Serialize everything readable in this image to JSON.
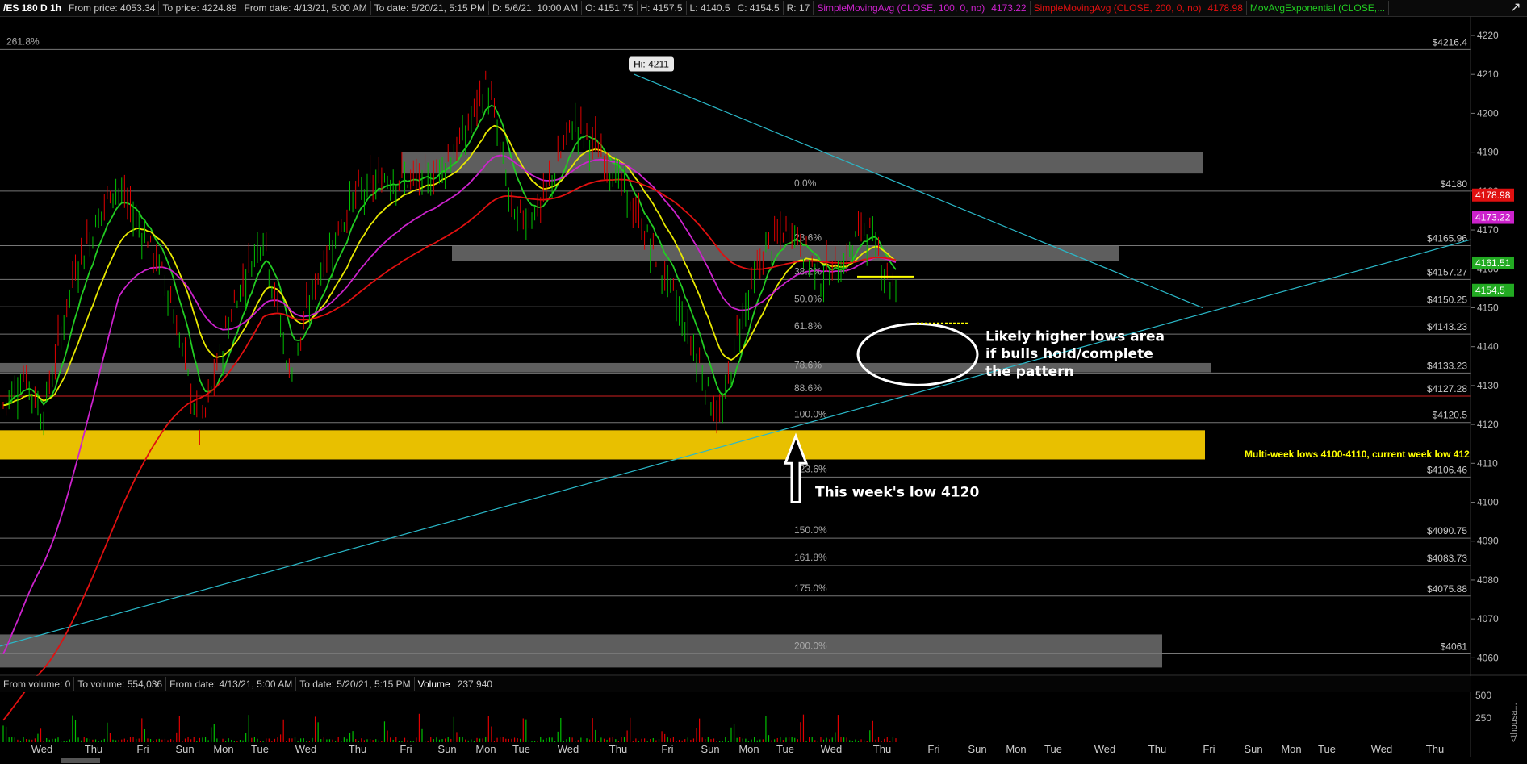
{
  "header": {
    "symbol": "/ES 180 D 1h",
    "from_price": "From price: 4053.34",
    "to_price": "To price: 4224.89",
    "from_date": "From date: 4/13/21, 5:00 AM",
    "to_date": "To date: 5/20/21, 5:15 PM",
    "bar_date": "D: 5/6/21, 10:00 AM",
    "open": "O: 4151.75",
    "high": "H: 4157.5",
    "low": "L: 4140.5",
    "close": "C: 4154.5",
    "range": "R: 17",
    "sma100_label": "SimpleMovingAvg (CLOSE, 100, 0, no)",
    "sma100_value": "4173.22",
    "sma200_label": "SimpleMovingAvg (CLOSE, 200, 0, no)",
    "sma200_value": "4178.98",
    "ema_label": "MovAvgExponential (CLOSE,..."
  },
  "colors": {
    "background": "#000000",
    "up_candle": "#00c000",
    "down_candle": "#e00000",
    "ema_fast": "#22cc22",
    "ema_slow": "#e8e800",
    "sma100": "#cc22cc",
    "sma200": "#e01010",
    "trendline": "#2ab8c8",
    "zone_gray": "#6e6e6e",
    "zone_yellow": "#e8c000"
  },
  "price_axis": {
    "ticks": [
      "4220",
      "4210",
      "4200",
      "4190",
      "4180",
      "4170",
      "4160",
      "4150",
      "4140",
      "4130",
      "4120",
      "4110",
      "4100",
      "4090",
      "4080",
      "4070",
      "4060"
    ],
    "badges": [
      {
        "value": "4178.98",
        "color": "#e01010"
      },
      {
        "value": "4173.22",
        "color": "#cc22cc"
      },
      {
        "value": "4161.51",
        "color": "#22aa22"
      },
      {
        "value": "4154.5",
        "color": "#22aa22"
      }
    ]
  },
  "levels": [
    {
      "price": 4216.4,
      "label": "$4216.4",
      "color": "#c8c8c8"
    },
    {
      "price": 4180,
      "label": "$4180",
      "color": "#c8c8c8"
    },
    {
      "price": 4165.96,
      "label": "$4165.96",
      "color": "#c8c8c8"
    },
    {
      "price": 4157.27,
      "label": "$4157.27",
      "color": "#c8c8c8"
    },
    {
      "price": 4150.25,
      "label": "$4150.25",
      "color": "#c8c8c8"
    },
    {
      "price": 4143.23,
      "label": "$4143.23",
      "color": "#c8c8c8"
    },
    {
      "price": 4133.23,
      "label": "$4133.23",
      "color": "#c8c8c8"
    },
    {
      "price": 4127.28,
      "label": "$4127.28",
      "color": "#ff3030"
    },
    {
      "price": 4120.5,
      "label": "$4120.5",
      "color": "#c8c8c8"
    },
    {
      "price": 4106.46,
      "label": "$4106.46",
      "color": "#c8c8c8"
    },
    {
      "price": 4090.75,
      "label": "$4090.75",
      "color": "#c8c8c8"
    },
    {
      "price": 4083.73,
      "label": "$4083.73",
      "color": "#c8c8c8"
    },
    {
      "price": 4075.88,
      "label": "$4075.88",
      "color": "#c8c8c8"
    },
    {
      "price": 4061,
      "label": "$4061",
      "color": "#c8c8c8"
    }
  ],
  "fib_labels": [
    {
      "price": 4216.4,
      "label": "261.8%"
    },
    {
      "price": 4180,
      "label": "0.0%"
    },
    {
      "price": 4165.96,
      "label": "23.6%"
    },
    {
      "price": 4157.27,
      "label": "38.2%"
    },
    {
      "price": 4150.25,
      "label": "50.0%"
    },
    {
      "price": 4143.23,
      "label": "61.8%"
    },
    {
      "price": 4133.23,
      "label": "78.6%"
    },
    {
      "price": 4127.28,
      "label": "88.6%"
    },
    {
      "price": 4120.5,
      "label": "100.0%"
    },
    {
      "price": 4106.46,
      "label": "123.6%"
    },
    {
      "price": 4090.75,
      "label": "150.0%"
    },
    {
      "price": 4083.73,
      "label": "161.8%"
    },
    {
      "price": 4075.88,
      "label": "175.0%"
    },
    {
      "price": 4061,
      "label": "200.0%"
    }
  ],
  "annotations": {
    "hi_label": "Hi: 4211",
    "higher_lows_line1": "Likely higher lows area",
    "higher_lows_line2": "if bulls hold/complete",
    "higher_lows_line3": "the pattern",
    "week_low": "This week's low 4120",
    "multi_week": "Multi-week lows 4100-4110, current week low 412"
  },
  "volume_header": {
    "from_volume": "From volume: 0",
    "to_volume": "To volume: 554,036",
    "from_date": "From date: 4/13/21, 5:00 AM",
    "to_date": "To date: 5/20/21, 5:15 PM",
    "label": "Volume",
    "value": "237,940"
  },
  "volume_axis": {
    "ticks": [
      "500",
      "250"
    ],
    "unit": "<thousa..."
  },
  "x_axis": {
    "days": [
      "Wed",
      "Thu",
      "Fri",
      "Sun",
      "Mon",
      "Tue",
      "Wed",
      "Thu",
      "Fri",
      "Sun",
      "Mon",
      "Tue",
      "Wed",
      "Thu",
      "Fri",
      "Sun",
      "Mon",
      "Tue",
      "Wed",
      "Thu",
      "Fri",
      "Sun",
      "Mon",
      "Tue",
      "Wed",
      "Thu",
      "Fri",
      "Sun",
      "Mon",
      "Tue",
      "Wed",
      "Thu"
    ]
  }
}
